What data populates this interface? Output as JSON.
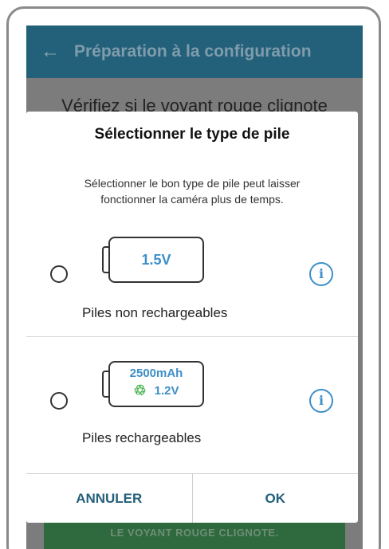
{
  "appbar": {
    "back_icon": "arrow-left-icon",
    "title": "Préparation à la configuration"
  },
  "background": {
    "instruction": "Vérifiez si le voyant rouge clignote",
    "footer_button": "LE VOYANT ROUGE CLIGNOTE."
  },
  "dialog": {
    "title": "Sélectionner le type de pile",
    "description": "Sélectionner le bon type de pile peut laisser fonctionner la caméra plus de temps.",
    "options": [
      {
        "battery_text": "1.5V",
        "label": "Piles non rechargeables",
        "selected": false,
        "info_icon": "info-icon"
      },
      {
        "battery_capacity": "2500mAh",
        "battery_voltage": "1.2V",
        "recycle_icon": "♲",
        "label": "Piles rechargeables",
        "selected": false,
        "info_icon": "info-icon"
      }
    ],
    "cancel_label": "ANNULER",
    "ok_label": "OK"
  },
  "colors": {
    "accent": "#23607a",
    "battery_text": "#3d8fc8",
    "recycle": "#3fae49",
    "footer": "#2e6a3e"
  }
}
